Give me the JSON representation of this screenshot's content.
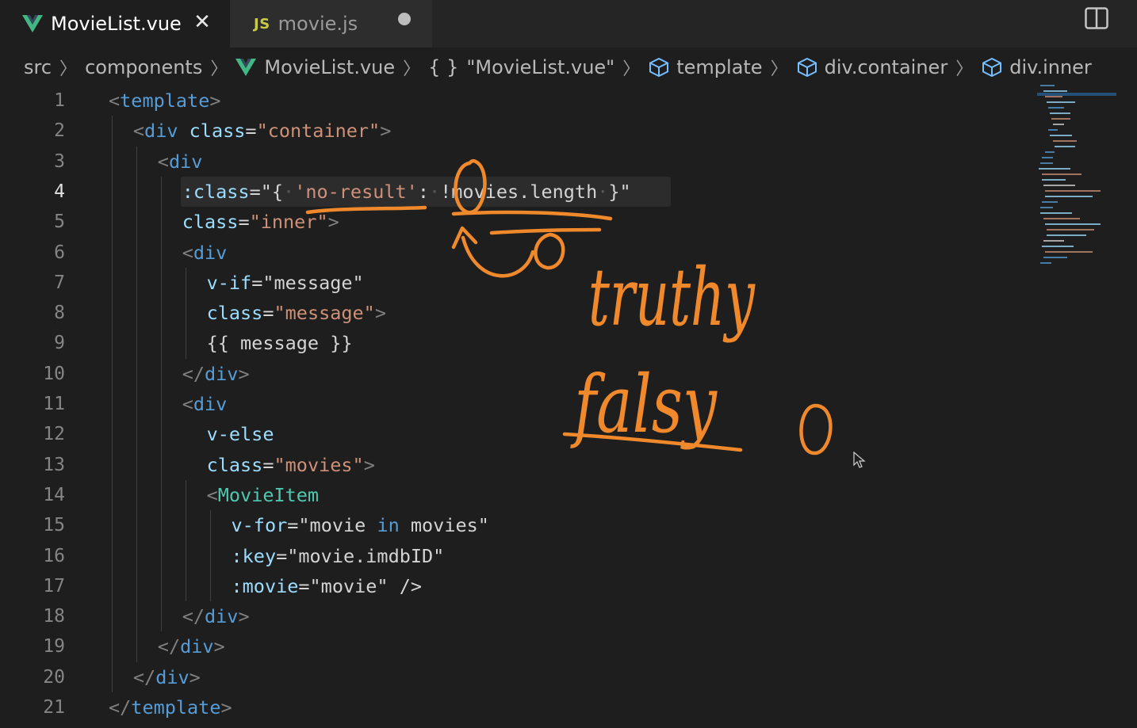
{
  "tabs": [
    {
      "label": "MovieList.vue",
      "icon": "vue-logo-icon",
      "active": true,
      "closable": true
    },
    {
      "label": "movie.js",
      "icon": "js-icon",
      "badge": "JS",
      "active": false,
      "dirty": true
    }
  ],
  "breadcrumb": {
    "items": [
      "src",
      "components",
      "MovieList.vue",
      "\"MovieList.vue\"",
      "template",
      "div.container",
      "div.inner"
    ],
    "braces": "{ }",
    "separator": ">"
  },
  "editor": {
    "current_line": 4,
    "line_numbers": [
      "1",
      "2",
      "3",
      "4",
      "5",
      "6",
      "7",
      "8",
      "9",
      "10",
      "11",
      "12",
      "13",
      "14",
      "15",
      "16",
      "17",
      "18",
      "19",
      "20",
      "21"
    ],
    "lines": [
      [
        [
          "br",
          "<"
        ],
        [
          "tag",
          "template"
        ],
        [
          "br",
          ">"
        ]
      ],
      [
        [
          "br",
          "<"
        ],
        [
          "tag",
          "div"
        ],
        [
          "txt",
          " "
        ],
        [
          "attr",
          "class"
        ],
        [
          "txt",
          "="
        ],
        [
          "str",
          "\"container\""
        ],
        [
          "br",
          ">"
        ]
      ],
      [
        [
          "br",
          "<"
        ],
        [
          "tag",
          "div"
        ]
      ],
      [
        [
          "attr",
          ":class"
        ],
        [
          "txt",
          "=\"{"
        ],
        [
          "ws",
          "·"
        ],
        [
          "str",
          "'no-result'"
        ],
        [
          "txt",
          ":"
        ],
        [
          "ws",
          "·"
        ],
        [
          "txt",
          "!movies.length"
        ],
        [
          "ws",
          "·"
        ],
        [
          "txt",
          "}\""
        ]
      ],
      [
        [
          "attr",
          "class"
        ],
        [
          "txt",
          "="
        ],
        [
          "str",
          "\"inner\""
        ],
        [
          "br",
          ">"
        ]
      ],
      [
        [
          "br",
          "<"
        ],
        [
          "tag",
          "div"
        ]
      ],
      [
        [
          "attr",
          "v-if"
        ],
        [
          "txt",
          "=\"message\""
        ]
      ],
      [
        [
          "attr",
          "class"
        ],
        [
          "txt",
          "="
        ],
        [
          "str",
          "\"message\""
        ],
        [
          "br",
          ">"
        ]
      ],
      [
        [
          "txt",
          "{{ message }}"
        ]
      ],
      [
        [
          "br",
          "</"
        ],
        [
          "tag",
          "div"
        ],
        [
          "br",
          ">"
        ]
      ],
      [
        [
          "br",
          "<"
        ],
        [
          "tag",
          "div"
        ]
      ],
      [
        [
          "attr",
          "v-else"
        ]
      ],
      [
        [
          "attr",
          "class"
        ],
        [
          "txt",
          "="
        ],
        [
          "str",
          "\"movies\""
        ],
        [
          "br",
          ">"
        ]
      ],
      [
        [
          "br",
          "<"
        ],
        [
          "comp",
          "MovieItem"
        ]
      ],
      [
        [
          "attr",
          "v-for"
        ],
        [
          "txt",
          "=\"movie "
        ],
        [
          "kw",
          "in"
        ],
        [
          "txt",
          " movies\""
        ]
      ],
      [
        [
          "attr",
          ":key"
        ],
        [
          "txt",
          "=\"movie.imdbID\""
        ]
      ],
      [
        [
          "attr",
          ":movie"
        ],
        [
          "txt",
          "=\"movie\" />"
        ]
      ],
      [
        [
          "br",
          "</"
        ],
        [
          "tag",
          "div"
        ],
        [
          "br",
          ">"
        ]
      ],
      [
        [
          "br",
          "</"
        ],
        [
          "tag",
          "div"
        ],
        [
          "br",
          ">"
        ]
      ],
      [
        [
          "br",
          "</"
        ],
        [
          "tag",
          "div"
        ],
        [
          "br",
          ">"
        ]
      ],
      [
        [
          "br",
          "</"
        ],
        [
          "tag",
          "template"
        ],
        [
          "br",
          ">"
        ]
      ]
    ],
    "indents": [
      0,
      1,
      2,
      3,
      3,
      3,
      4,
      4,
      4,
      3,
      3,
      4,
      4,
      4,
      5,
      5,
      5,
      3,
      2,
      1,
      0
    ]
  },
  "annotations": {
    "handwritten": [
      "truthy",
      "falsy",
      "0"
    ],
    "color": "#f0882c"
  },
  "colors": {
    "background": "#1e1e1e",
    "tag": "#569cd6",
    "component": "#4ec9b0",
    "attribute": "#9cdcfe",
    "string": "#ce9178",
    "ink": "#f0882c"
  }
}
